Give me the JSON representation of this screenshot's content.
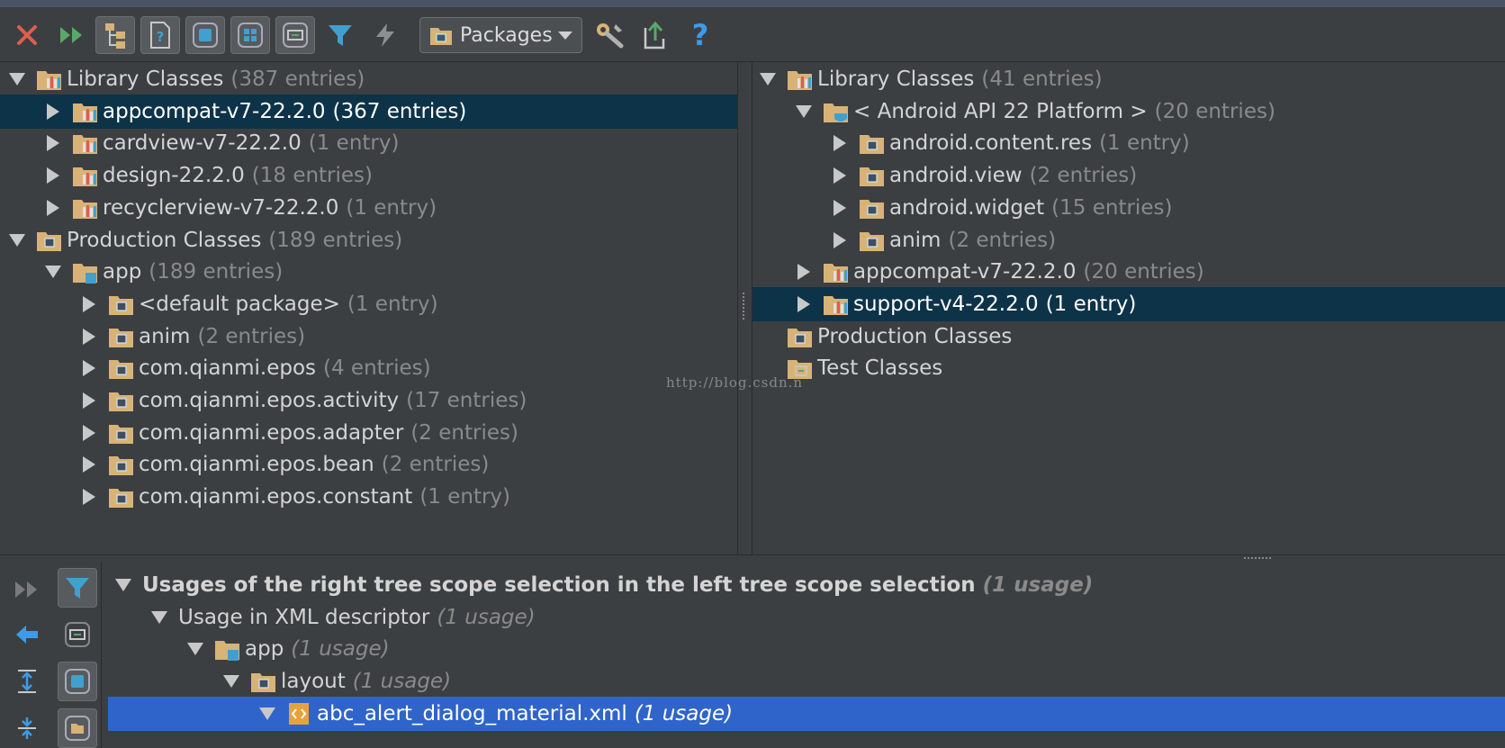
{
  "toolbar": {
    "scope_combo_label": "Packages",
    "help_glyph": "?"
  },
  "left_tree": [
    {
      "depth": 0,
      "expand": "down",
      "icon": "library",
      "name": "Library Classes",
      "count": "(387 entries)"
    },
    {
      "depth": 1,
      "expand": "right",
      "icon": "library",
      "name": "appcompat-v7-22.2.0",
      "count": "(367 entries)",
      "selected": true
    },
    {
      "depth": 1,
      "expand": "right",
      "icon": "library",
      "name": "cardview-v7-22.2.0",
      "count": "(1 entry)"
    },
    {
      "depth": 1,
      "expand": "right",
      "icon": "library",
      "name": "design-22.2.0",
      "count": "(18 entries)"
    },
    {
      "depth": 1,
      "expand": "right",
      "icon": "library",
      "name": "recyclerview-v7-22.2.0",
      "count": "(1 entry)"
    },
    {
      "depth": 0,
      "expand": "down",
      "icon": "package",
      "name": "Production Classes",
      "count": "(189 entries)"
    },
    {
      "depth": 1,
      "expand": "down",
      "icon": "module",
      "name": "app",
      "count": "(189 entries)"
    },
    {
      "depth": 2,
      "expand": "right",
      "icon": "package",
      "name": "<default package>",
      "count": "(1 entry)"
    },
    {
      "depth": 2,
      "expand": "right",
      "icon": "package",
      "name": "anim",
      "count": "(2 entries)"
    },
    {
      "depth": 2,
      "expand": "right",
      "icon": "package",
      "name": "com.qianmi.epos",
      "count": "(4 entries)"
    },
    {
      "depth": 2,
      "expand": "right",
      "icon": "package",
      "name": "com.qianmi.epos.activity",
      "count": "(17 entries)"
    },
    {
      "depth": 2,
      "expand": "right",
      "icon": "package",
      "name": "com.qianmi.epos.adapter",
      "count": "(2 entries)"
    },
    {
      "depth": 2,
      "expand": "right",
      "icon": "package",
      "name": "com.qianmi.epos.bean",
      "count": "(2 entries)"
    },
    {
      "depth": 2,
      "expand": "right",
      "icon": "package",
      "name": "com.qianmi.epos.constant",
      "count": "(1 entry)"
    }
  ],
  "right_tree": [
    {
      "depth": 0,
      "expand": "down",
      "icon": "library",
      "name": "Library Classes",
      "count": "(41 entries)"
    },
    {
      "depth": 1,
      "expand": "down",
      "icon": "sdk",
      "name": "< Android API 22 Platform >",
      "count": "(20 entries)"
    },
    {
      "depth": 2,
      "expand": "right",
      "icon": "package",
      "name": "android.content.res",
      "count": "(1 entry)"
    },
    {
      "depth": 2,
      "expand": "right",
      "icon": "package",
      "name": "android.view",
      "count": "(2 entries)"
    },
    {
      "depth": 2,
      "expand": "right",
      "icon": "package",
      "name": "android.widget",
      "count": "(15 entries)"
    },
    {
      "depth": 2,
      "expand": "right",
      "icon": "package",
      "name": "anim",
      "count": "(2 entries)"
    },
    {
      "depth": 1,
      "expand": "right",
      "icon": "library",
      "name": "appcompat-v7-22.2.0",
      "count": "(20 entries)"
    },
    {
      "depth": 1,
      "expand": "right",
      "icon": "library",
      "name": "support-v4-22.2.0",
      "count": "(1 entry)",
      "selected": true
    },
    {
      "depth": 0,
      "expand": "none",
      "icon": "package",
      "name": "Production Classes",
      "count": ""
    },
    {
      "depth": 0,
      "expand": "none",
      "icon": "test",
      "name": "Test Classes",
      "count": ""
    }
  ],
  "usages_tree": [
    {
      "depth": 0,
      "expand": "down",
      "icon": "none",
      "name": "Usages of the right tree scope selection in the left tree scope selection",
      "count": "(1 usage)",
      "bold": true
    },
    {
      "depth": 1,
      "expand": "down",
      "icon": "none",
      "name": "Usage in XML descriptor",
      "count": "(1 usage)"
    },
    {
      "depth": 2,
      "expand": "down",
      "icon": "module",
      "name": "app",
      "count": "(1 usage)"
    },
    {
      "depth": 3,
      "expand": "down",
      "icon": "folder",
      "name": "layout",
      "count": "(1 usage)"
    },
    {
      "depth": 4,
      "expand": "down",
      "icon": "xml",
      "name": "abc_alert_dialog_material.xml",
      "count": "(1 usage)",
      "selected": true
    }
  ],
  "watermark": "http://blog.csdn.n",
  "colors": {
    "background": "#3c3f41",
    "selection_dark": "#0d3349",
    "selection_active": "#2f65ca",
    "close_red": "#e05d4f",
    "run_green": "#59a869",
    "filter_blue": "#40a0d0",
    "help_blue": "#3d9be9",
    "folder_tan": "#d7b378"
  }
}
